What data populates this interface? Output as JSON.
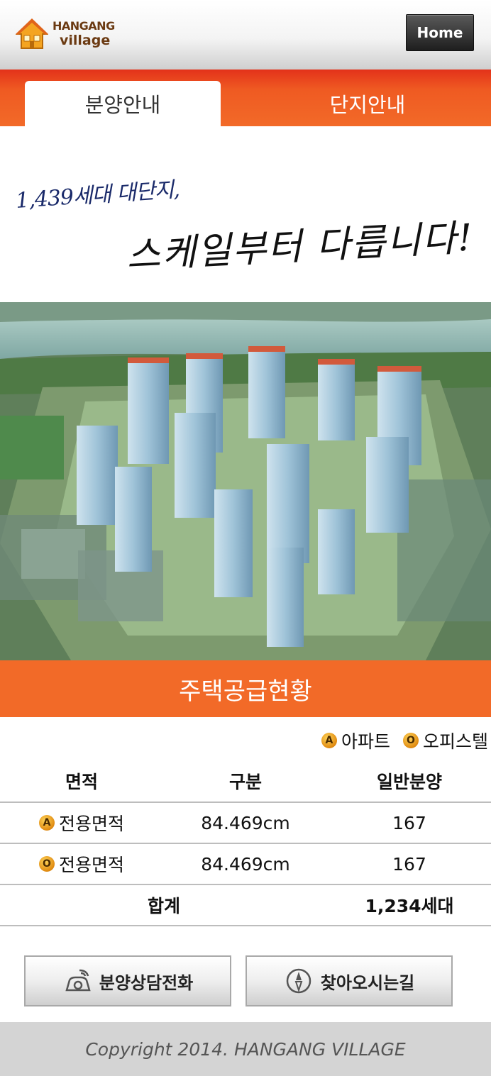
{
  "header": {
    "logo_line1": "HANGANG",
    "logo_line2": "village",
    "home_label": "Home"
  },
  "tabs": [
    {
      "label": "분양안내",
      "active": true
    },
    {
      "label": "단지안내",
      "active": false
    }
  ],
  "slogan": {
    "line1": "1,439세대 대단지,",
    "line2": "스케일부터 다릅니다!"
  },
  "supply": {
    "title": "주택공급현황",
    "legend": [
      {
        "badge": "A",
        "label": "아파트"
      },
      {
        "badge": "O",
        "label": "오피스텔"
      }
    ],
    "headers": [
      "면적",
      "구분",
      "일반분양"
    ],
    "rows": [
      {
        "badge": "A",
        "area": "전용면적",
        "type": "84.469cm",
        "count": "167"
      },
      {
        "badge": "O",
        "area": "전용면적",
        "type": "84.469cm",
        "count": "167"
      }
    ],
    "total_label": "합계",
    "total_value": "1,234세대"
  },
  "buttons": {
    "call_label": "분양상담전화",
    "directions_label": "찾아오시는길"
  },
  "footer": {
    "copyright": "Copyright 2014. HANGANG VILLAGE"
  },
  "colors": {
    "accent_orange": "#f26a28",
    "brand_brown": "#6b3a12"
  },
  "icons": [
    "house-logo-icon",
    "phone-icon",
    "compass-icon"
  ]
}
